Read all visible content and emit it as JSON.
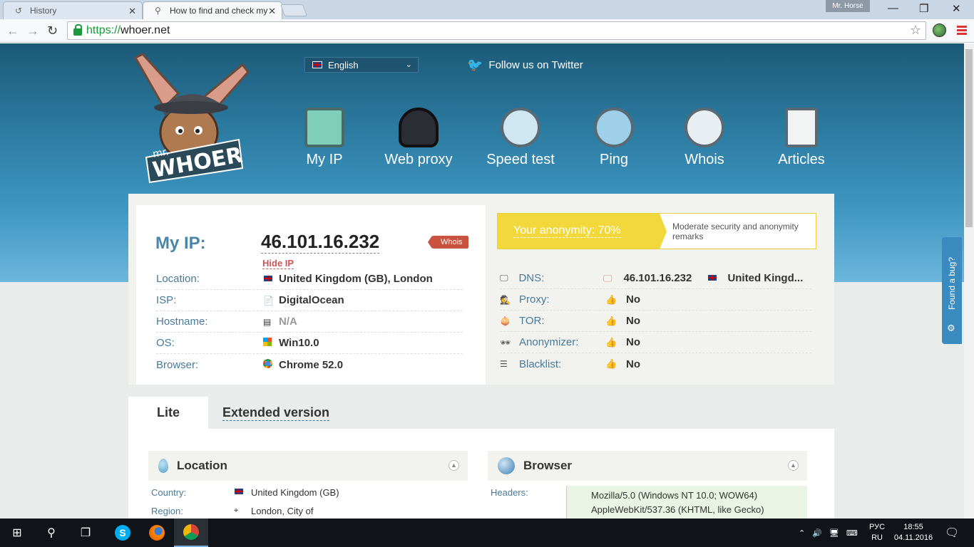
{
  "browser": {
    "tabs": [
      {
        "title": "History",
        "icon": "history-icon"
      },
      {
        "title": "How to find and check my",
        "icon": "search-icon"
      }
    ],
    "user": "Mr. Horse",
    "url_scheme": "https://",
    "url_host": "whoer.net"
  },
  "site": {
    "language": "English",
    "twitter": "Follow us on Twitter",
    "nav": [
      {
        "label": "My IP",
        "icon": "house-icon"
      },
      {
        "label": "Web proxy",
        "icon": "spy-hat-icon"
      },
      {
        "label": "Speed test",
        "icon": "speedometer-icon"
      },
      {
        "label": "Ping",
        "icon": "radar-icon"
      },
      {
        "label": "Whois",
        "icon": "question-icon"
      },
      {
        "label": "Articles",
        "icon": "document-icon"
      }
    ],
    "logo_small": "mr.",
    "logo_text": "WHOER"
  },
  "ip": {
    "label": "My IP:",
    "value": "46.101.16.232",
    "hide": "Hide IP",
    "whois": "Whois"
  },
  "details": [
    {
      "key": "Location:",
      "value": "United Kingdom (GB), London",
      "icon": "uk-flag-icon"
    },
    {
      "key": "ISP:",
      "value": "DigitalOcean",
      "icon": "isp-icon"
    },
    {
      "key": "Hostname:",
      "value": "N/A",
      "icon": "server-icon"
    },
    {
      "key": "OS:",
      "value": "Win10.0",
      "icon": "windows-icon"
    },
    {
      "key": "Browser:",
      "value": "Chrome 52.0",
      "icon": "chrome-icon"
    }
  ],
  "anonymity": {
    "label": "Your anonymity: 70%",
    "percent": 70,
    "remark": "Moderate security and anonymity remarks"
  },
  "checks": [
    {
      "key": "DNS:",
      "value": "46.101.16.232",
      "extra": "United Kingd...",
      "icon": "monitor-icon"
    },
    {
      "key": "Proxy:",
      "value": "No",
      "icon": "spy-icon"
    },
    {
      "key": "TOR:",
      "value": "No",
      "icon": "onion-icon"
    },
    {
      "key": "Anonymizer:",
      "value": "No",
      "icon": "glasses-icon"
    },
    {
      "key": "Blacklist:",
      "value": "No",
      "icon": "list-icon"
    }
  ],
  "page_tabs": {
    "lite": "Lite",
    "extended": "Extended version"
  },
  "location_panel": {
    "title": "Location",
    "rows": [
      {
        "key": "Country:",
        "value": "United Kingdom (GB)"
      },
      {
        "key": "Region:",
        "value": "London, City of"
      }
    ]
  },
  "browser_panel": {
    "title": "Browser",
    "headers_key": "Headers:",
    "headers_line1": "Mozilla/5.0 (Windows NT 10.0; WOW64)",
    "headers_line2": "AppleWebKit/537.36 (KHTML, like Gecko)"
  },
  "bug_tab": "Found a bug?",
  "taskbar": {
    "lang_top": "РУС",
    "lang_bottom": "RU",
    "time": "18:55",
    "date": "04.11.2016"
  }
}
